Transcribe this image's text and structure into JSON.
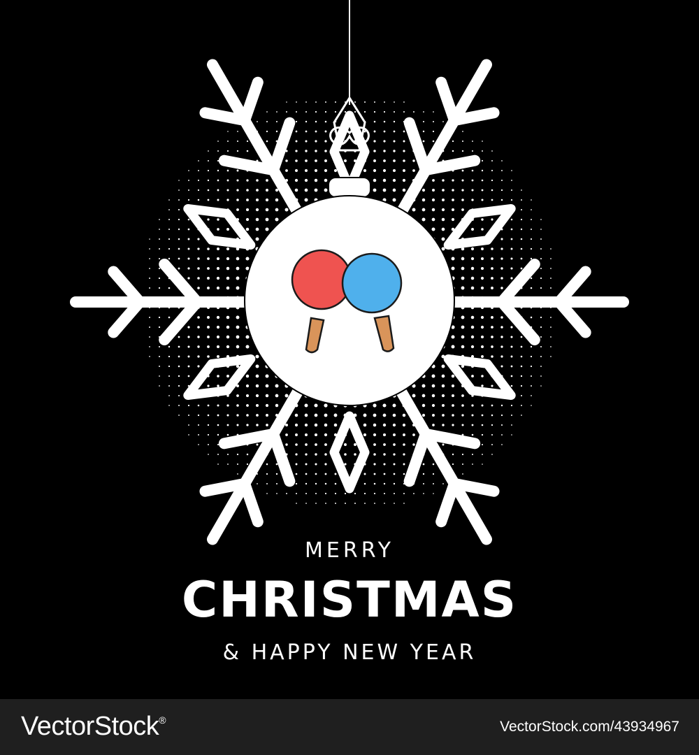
{
  "greeting": {
    "line1": "MERRY",
    "line2": "CHRISTMAS",
    "line3": "& HAPPY NEW YEAR"
  },
  "footer": {
    "brand": "VectorStock",
    "trademark": "®",
    "stock_id": "VectorStock.com/43934967"
  },
  "colors": {
    "background": "#000000",
    "foreground": "#ffffff",
    "footer_bar": "#1f1f1f",
    "paddle_red": "#ef5350",
    "paddle_blue": "#4fb0ec",
    "paddle_handle": "#d9945a"
  },
  "icons": [
    "snowflake-icon",
    "christmas-ornament-icon",
    "ping-pong-paddle-icon"
  ]
}
